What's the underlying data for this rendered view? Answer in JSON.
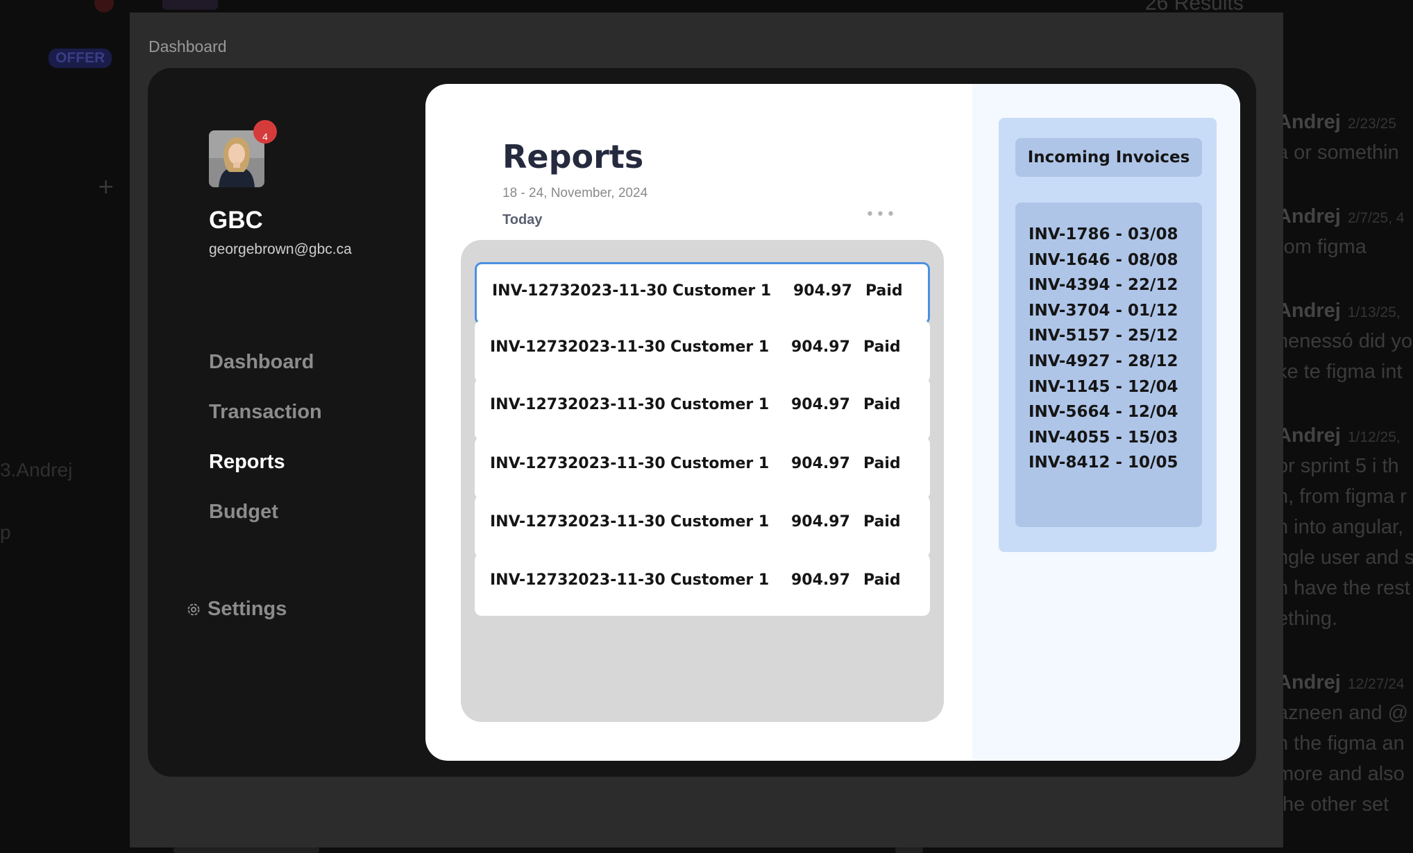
{
  "background": {
    "offer_badge": "OFFER",
    "left_snippets": [
      "3.Andrej",
      "p"
    ],
    "results": "26 Results",
    "chat_lines": [
      {
        "who": "Andrej",
        "ts": "2/23/25",
        "text": ""
      },
      {
        "who": "",
        "ts": "",
        "text": "a or somethin"
      },
      {
        "who": "Andrej",
        "ts": "2/7/25, 4",
        "text": ""
      },
      {
        "who": "",
        "ts": "",
        "text": "rom figma"
      },
      {
        "who": "Andrej",
        "ts": "1/13/25,",
        "text": ""
      },
      {
        "who": "",
        "ts": "",
        "text": "henessó did yo"
      },
      {
        "who": "",
        "ts": "",
        "text": "ke te figma int"
      },
      {
        "who": "Andrej",
        "ts": "1/12/25,",
        "text": ""
      },
      {
        "who": "",
        "ts": "",
        "text": "or sprint 5 i th"
      },
      {
        "who": "",
        "ts": "",
        "text": "n, from figma r"
      },
      {
        "who": "",
        "ts": "",
        "text": "n into angular,"
      },
      {
        "who": "",
        "ts": "",
        "text": "ngle user and s"
      },
      {
        "who": "",
        "ts": "",
        "text": "n have the rest"
      },
      {
        "who": "",
        "ts": "",
        "text": "ething."
      },
      {
        "who": "Andrej",
        "ts": "12/27/24",
        "text": ""
      },
      {
        "who": "",
        "ts": "",
        "text": "azneen and @"
      },
      {
        "who": "",
        "ts": "",
        "text": "n the figma an"
      },
      {
        "who": "",
        "ts": "",
        "text": "more and also"
      },
      {
        "who": "",
        "ts": "",
        "text": "the other set"
      }
    ]
  },
  "modal": {
    "title": "Dashboard"
  },
  "sidebar": {
    "notification_count": "4",
    "brand": "GBC",
    "email": "georgebrown@gbc.ca",
    "nav": [
      {
        "label": "Dashboard",
        "active": false
      },
      {
        "label": "Transaction",
        "active": false
      },
      {
        "label": "Reports",
        "active": true
      },
      {
        "label": "Budget",
        "active": false
      }
    ],
    "settings_label": "Settings",
    "settings_icon": "gear-icon"
  },
  "reports": {
    "title": "Reports",
    "date_range": "18 - 24, November, 2024",
    "today_label": "Today",
    "more_icon": "ellipsis-icon",
    "selected_row": 0,
    "rows": [
      {
        "invoice": "INV-1273",
        "date": "2023-11-30",
        "customer": "Customer 1",
        "amount": "904.97",
        "status": "Paid"
      },
      {
        "invoice": "INV-1273",
        "date": "2023-11-30",
        "customer": "Customer 1",
        "amount": "904.97",
        "status": "Paid"
      },
      {
        "invoice": "INV-1273",
        "date": "2023-11-30",
        "customer": "Customer 1",
        "amount": "904.97",
        "status": "Paid"
      },
      {
        "invoice": "INV-1273",
        "date": "2023-11-30",
        "customer": "Customer 1",
        "amount": "904.97",
        "status": "Paid"
      },
      {
        "invoice": "INV-1273",
        "date": "2023-11-30",
        "customer": "Customer 1",
        "amount": "904.97",
        "status": "Paid"
      },
      {
        "invoice": "INV-1273",
        "date": "2023-11-30",
        "customer": "Customer 1",
        "amount": "904.97",
        "status": "Paid"
      }
    ]
  },
  "incoming": {
    "title": "Incoming Invoices",
    "items": [
      "INV-1786 - 03/08",
      "INV-1646 - 08/08",
      "INV-4394 - 22/12",
      "INV-3704 - 01/12",
      "INV-5157 - 25/12",
      "INV-4927 - 28/12",
      "INV-1145 - 12/04",
      "INV-5664 - 12/04",
      "INV-4055 - 15/03",
      "INV-8412 - 10/05"
    ]
  },
  "colors": {
    "accent_selected": "#4a90e2",
    "badge": "#d63b3b",
    "invoice_panel": "#c9dcf7"
  }
}
